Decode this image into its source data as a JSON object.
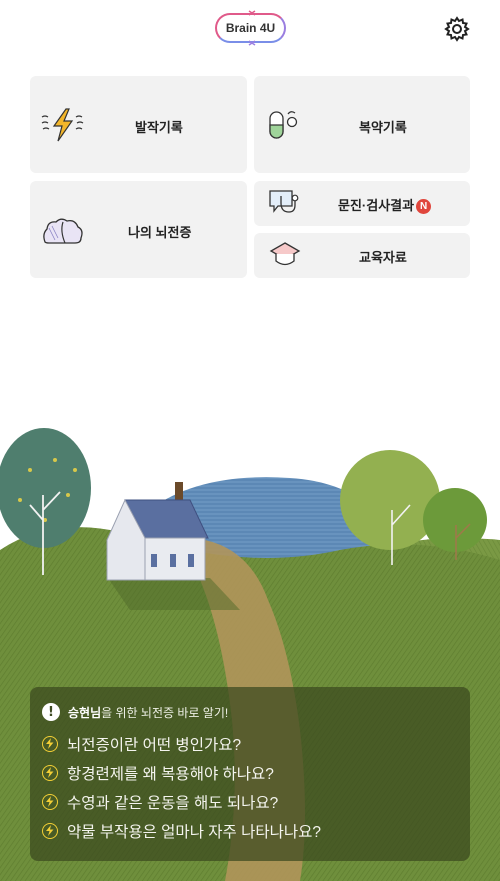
{
  "header": {
    "logo_text": "Brain 4U",
    "settings_icon": "gear-icon"
  },
  "menu": {
    "seizure_record": {
      "label": "발작기록",
      "icon": "lightning-icon"
    },
    "medication_record": {
      "label": "복약기록",
      "icon": "pill-icon"
    },
    "my_epilepsy": {
      "label": "나의 뇌전증",
      "icon": "brain-icon"
    },
    "consultation_results": {
      "label": "문진·검사결과",
      "icon": "stethoscope-chat-icon",
      "badge": "N"
    },
    "education": {
      "label": "교육자료",
      "icon": "graduation-cap-icon"
    }
  },
  "info": {
    "user_name": "승현님",
    "heading_suffix": "을 위한 뇌전증 바로 알기!",
    "questions": [
      "뇌전증이란 어떤 병인가요?",
      "항경련제를 왜 복용해야 하나요?",
      "수영과 같은 운동을 해도 되나요?",
      "약물 부작용은 얼마나 자주 나타나나요?"
    ]
  },
  "colors": {
    "accent_pink": "#e05a8a",
    "accent_purple": "#9a7ee0",
    "badge_red": "#e0463c",
    "bolt_yellow": "#f3cf35",
    "card_bg": "#f2f2f2"
  }
}
